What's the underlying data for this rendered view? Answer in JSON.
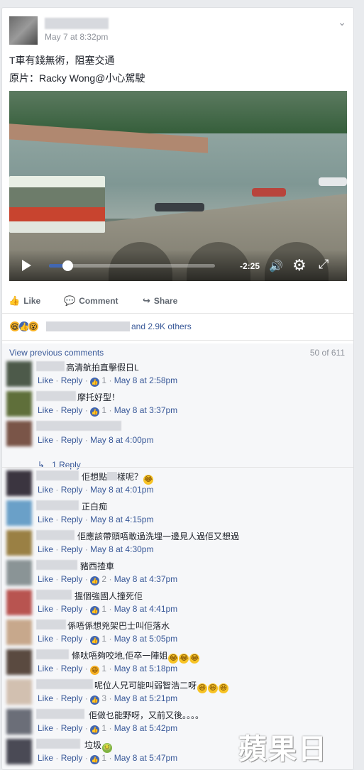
{
  "post": {
    "timestamp": "May 7 at 8:32pm",
    "line1": "T車有錢無術，阻塞交通",
    "line2": "原片：Racky Wong@小心駕駛"
  },
  "video": {
    "time_remaining": "-2:25",
    "progress_fraction": 0.11
  },
  "actions": {
    "like": "Like",
    "comment": "Comment",
    "share": "Share"
  },
  "reactions": {
    "others_text": "and 2.9K others"
  },
  "comments_header": {
    "view_previous": "View previous comments",
    "count": "50 of 611"
  },
  "comments": [
    {
      "text": "高清航拍直擊假日L",
      "likes": "1",
      "time": "May 8 at 2:58pm"
    },
    {
      "text": "摩托好型！",
      "likes": "1",
      "time": "May 8 at 3:37pm"
    },
    {
      "text": "",
      "likes": "",
      "time": "May 8 at 4:00pm",
      "replies": "1 Reply"
    },
    {
      "text": "佢想點",
      "text2": "樣呢？",
      "likes": "",
      "time": "May 8 at 4:01pm"
    },
    {
      "text": "正白痴",
      "likes": "",
      "time": "May 8 at 4:15pm"
    },
    {
      "text": "佢應該帶頭唔敢過洗埋一邊見人過佢又想過",
      "likes": "",
      "time": "May 8 at 4:30pm"
    },
    {
      "text": "豬西揸車",
      "likes": "2",
      "time": "May 8 at 4:37pm"
    },
    {
      "text": "搵個強國人撞死佢",
      "likes": "1",
      "time": "May 8 at 4:41pm"
    },
    {
      "text": "係唔係想兇架巴士叫佢落水",
      "likes": "1",
      "time": "May 8 at 5:05pm"
    },
    {
      "text": "條呔唔夠咬地,佢卒一陣姐",
      "likes": "1",
      "time": "May 8 at 5:18pm"
    },
    {
      "text": "呢位人兄可能叫弱智浩二呀",
      "likes": "3",
      "time": "May 8 at 5:21pm"
    },
    {
      "text": "佢做乜能野呀，又前又後。。。。",
      "likes": "1",
      "time": "May 8 at 5:42pm"
    },
    {
      "text": "垃圾",
      "likes": "1",
      "time": "May 8 at 5:47pm"
    }
  ],
  "labels": {
    "like": "Like",
    "reply": "Reply",
    "dot": "·"
  },
  "watermark": "蘋果日報",
  "colors": {
    "link": "#385898",
    "meta": "#90949c",
    "like_blue": "#4267b2",
    "background": "#e9ebee"
  }
}
